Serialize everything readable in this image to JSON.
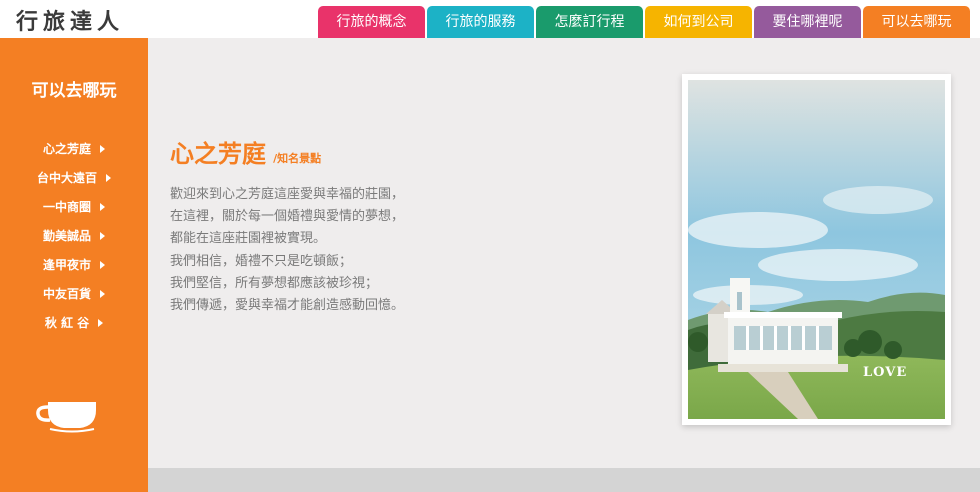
{
  "brand": {
    "logo_text": "行旅達人"
  },
  "nav": {
    "tabs": [
      {
        "label": "行旅的概念",
        "color": "#e9336a"
      },
      {
        "label": "行旅的服務",
        "color": "#1cb2c6"
      },
      {
        "label": "怎麼訂行程",
        "color": "#1a9b6c"
      },
      {
        "label": "如何到公司",
        "color": "#f6b400"
      },
      {
        "label": "要住哪裡呢",
        "color": "#955a9c"
      },
      {
        "label": "可以去哪玩",
        "color": "#f47f23"
      }
    ]
  },
  "sidebar": {
    "title": "可以去哪玩",
    "items": [
      {
        "label": "心之芳庭"
      },
      {
        "label": "台中大遠百"
      },
      {
        "label": "一中商圈"
      },
      {
        "label": "勤美誠品"
      },
      {
        "label": "逢甲夜市"
      },
      {
        "label": "中友百貨"
      },
      {
        "label": "秋 紅 谷"
      }
    ],
    "bottom_icon": "coffee-cup-icon"
  },
  "main": {
    "title": "心之芳庭",
    "subtitle": "/知名景點",
    "paragraphs": [
      "歡迎來到心之芳庭這座愛與幸福的莊園，",
      "在這裡，關於每一個婚禮與愛情的夢想，",
      "都能在這座莊園裡被實現。",
      "我們相信，婚禮不只是吃頓飯；",
      "我們堅信，所有夢想都應該被珍視；",
      "我們傳遞，愛與幸福才能創造感動回憶。"
    ],
    "photo": {
      "sign_text": "LOVE"
    }
  },
  "colors": {
    "accent": "#f47f23",
    "content_bg": "#efeded",
    "footer_bar": "#d4d4d4",
    "body_text": "#7a7a7a"
  }
}
